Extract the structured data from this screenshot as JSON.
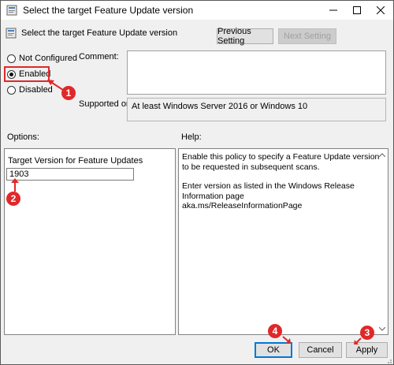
{
  "window": {
    "title": "Select the target Feature Update version"
  },
  "header": {
    "title": "Select the target Feature Update version",
    "prev_label": "Previous Setting",
    "next_label": "Next Setting"
  },
  "state": {
    "options": [
      {
        "label": "Not Configured",
        "selected": false
      },
      {
        "label": "Enabled",
        "selected": true
      },
      {
        "label": "Disabled",
        "selected": false
      }
    ]
  },
  "comment": {
    "label": "Comment:",
    "value": ""
  },
  "supported": {
    "label": "Supported on:",
    "value": "At least Windows Server 2016 or Windows 10"
  },
  "options_pane": {
    "label": "Options:",
    "field_label": "Target Version for Feature Updates",
    "field_value": "1903"
  },
  "help_pane": {
    "label": "Help:",
    "paragraph1": "Enable this policy to specify a Feature Update version to be requested in subsequent scans.",
    "paragraph2a": "Enter version as listed in the Windows Release Information page",
    "paragraph2b": "aka.ms/ReleaseInformationPage"
  },
  "footer": {
    "ok_label": "OK",
    "cancel_label": "Cancel",
    "apply_label": "Apply"
  },
  "markers": [
    "1",
    "2",
    "3",
    "4"
  ],
  "colors": {
    "annotation": "#e0282a",
    "focus": "#0078d7"
  }
}
